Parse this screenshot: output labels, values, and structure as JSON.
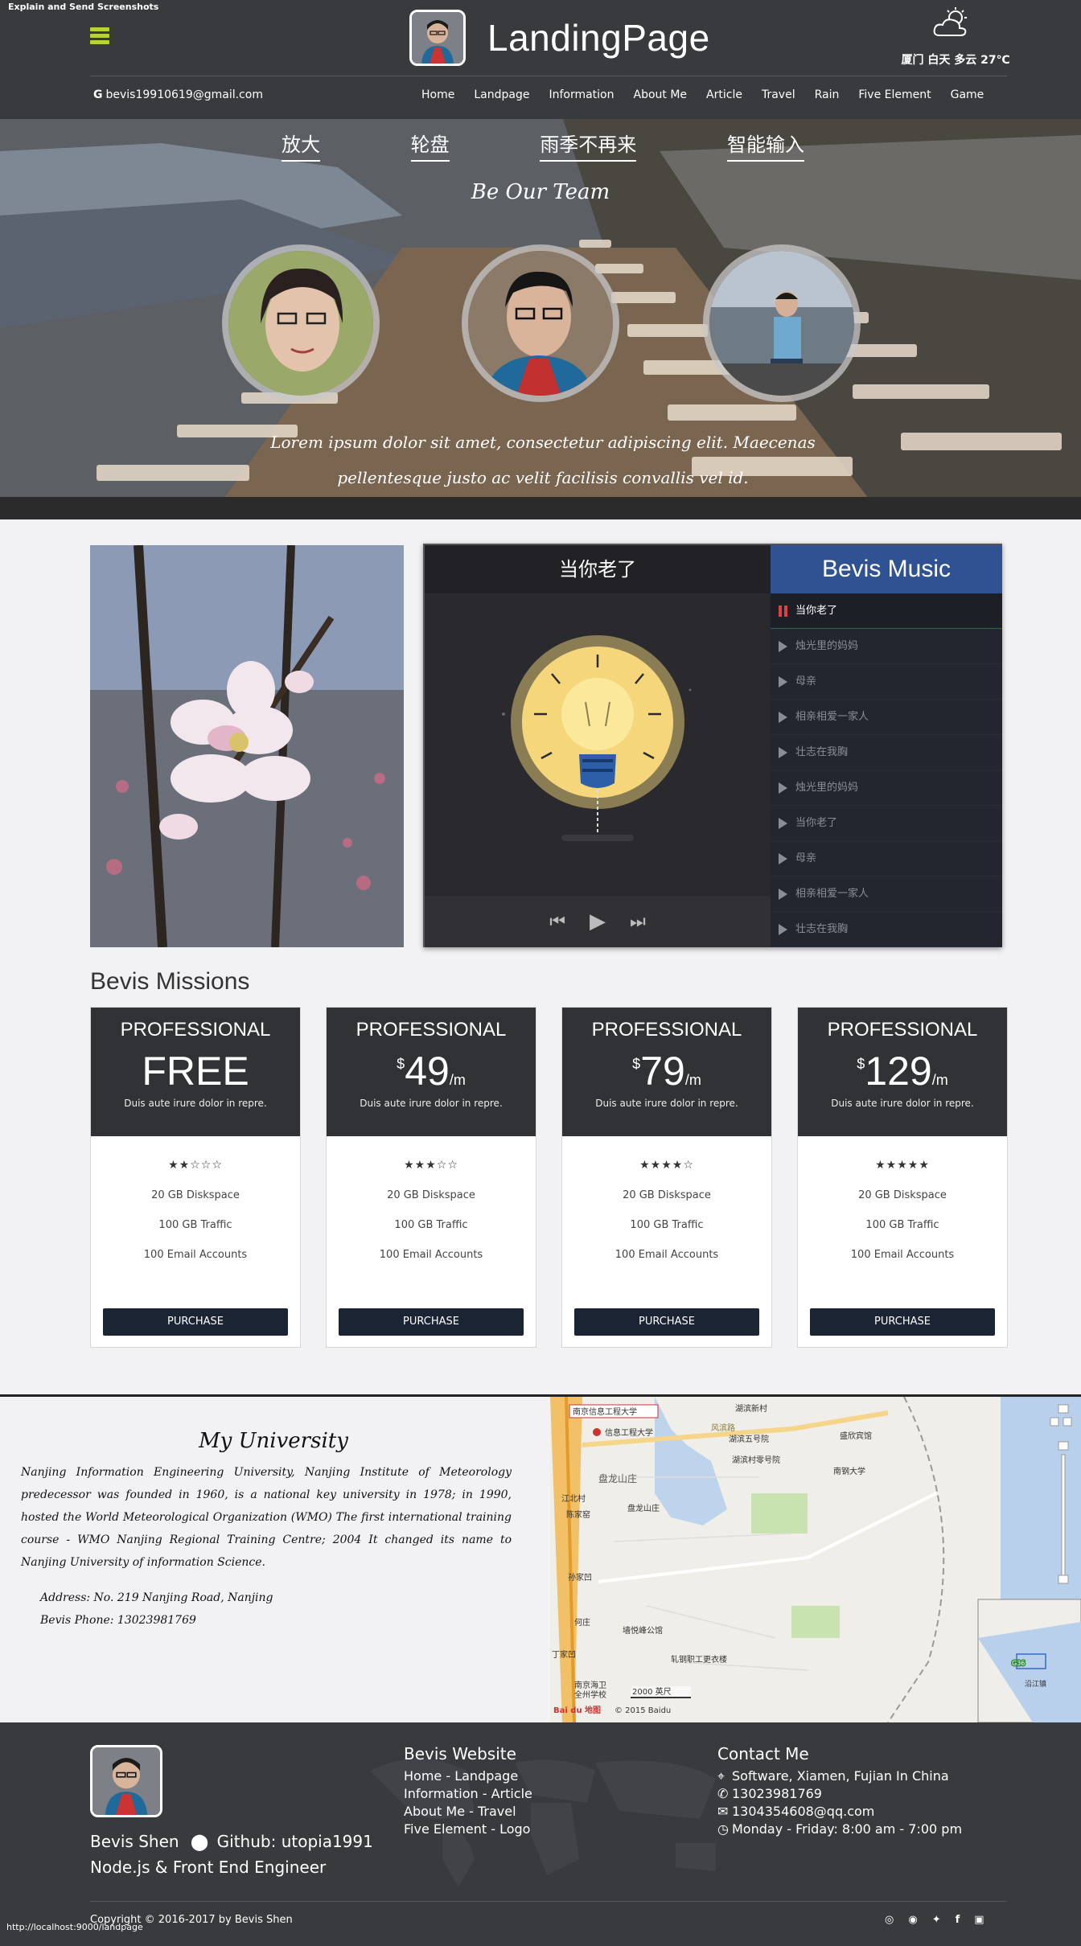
{
  "header": {
    "note": "Explain and Send Screenshots",
    "title": "LandingPage",
    "weather": "厦门 白天 多云 27℃",
    "email": "bevis19910619@gmail.com",
    "nav": [
      "Home",
      "Landpage",
      "Information",
      "About Me",
      "Article",
      "Travel",
      "Rain",
      "Five Element",
      "Game"
    ]
  },
  "hero": {
    "tabs": [
      "放大",
      "轮盘",
      "雨季不再来",
      "智能输入"
    ],
    "team_title": "Be Our Team",
    "text": "Lorem ipsum dolor sit amet, consectetur adipiscing elit. Maecenas pellentesque justo ac velit facilisis convallis vel id."
  },
  "player": {
    "song_title": "当你老了",
    "music_title": "Bevis Music",
    "playlist": [
      "当你老了",
      "烛光里的妈妈",
      "母亲",
      "相亲相爱一家人",
      "壮志在我胸",
      "烛光里的妈妈",
      "当你老了",
      "母亲",
      "相亲相爱一家人",
      "壮志在我胸"
    ]
  },
  "missions": {
    "title": "Bevis Missions",
    "plans": [
      {
        "name": "PROFESSIONAL",
        "currency": "",
        "price": "FREE",
        "per": "",
        "desc": "Duis aute irure dolor in repre.",
        "stars": "★★☆☆☆",
        "rating": 2.5,
        "features": [
          "20 GB Diskspace",
          "100 GB Traffic",
          "100 Email Accounts"
        ],
        "button": "PURCHASE"
      },
      {
        "name": "PROFESSIONAL",
        "currency": "$",
        "price": "49",
        "per": "/m",
        "desc": "Duis aute irure dolor in repre.",
        "stars": "★★★☆☆",
        "rating": 3,
        "features": [
          "20 GB Diskspace",
          "100 GB Traffic",
          "100 Email Accounts"
        ],
        "button": "PURCHASE"
      },
      {
        "name": "PROFESSIONAL",
        "currency": "$",
        "price": "79",
        "per": "/m",
        "desc": "Duis aute irure dolor in repre.",
        "stars": "★★★★☆",
        "rating": 4.5,
        "features": [
          "20 GB Diskspace",
          "100 GB Traffic",
          "100 Email Accounts"
        ],
        "button": "PURCHASE"
      },
      {
        "name": "PROFESSIONAL",
        "currency": "$",
        "price": "129",
        "per": "/m",
        "desc": "Duis aute irure dolor in repre.",
        "stars": "★★★★★",
        "rating": 5,
        "features": [
          "20 GB Diskspace",
          "100 GB Traffic",
          "100 Email Accounts"
        ],
        "button": "PURCHASE"
      }
    ]
  },
  "university": {
    "title": "My University",
    "body": "Nanjing Information Engineering University, Nanjing Institute of Meteorology predecessor was founded in 1960, is a national key university in 1978; in 1990, hosted the World Meteorological Organization (WMO) The first international training course - WMO Nanjing Regional Training Centre; 2004 It changed its name to Nanjing University of information Science.",
    "address": "Address: No. 219 Nanjing Road, Nanjing",
    "phone": "Bevis Phone: 13023981769"
  },
  "map": {
    "labels": [
      "南京信息工程大学",
      "信息工程大学",
      "盘龙山庄",
      "盘龙山庄",
      "湖滨新村",
      "湖滨五号院",
      "湖滨村零号院",
      "盛欣宾馆",
      "南钢大学",
      "风滨路",
      "江北村",
      "陈家窑",
      "孙家凹",
      "何庄",
      "墙悦峰公馆",
      "轧钢职工更衣楼",
      "丁家凹",
      "南京海卫",
      "全州学校",
      "沿江镇",
      "G36"
    ],
    "scale": "2000 英尺",
    "copyright": "© 2015 Baidu",
    "brand": "Bai du 地图"
  },
  "footer": {
    "name": "Bevis Shen",
    "github": "Github: utopia1991",
    "role": "Node.js & Front End Engineer",
    "website_title": "Bevis Website",
    "website_links": [
      "Home - Landpage",
      "Information - Article",
      "About Me - Travel",
      "Five Element - Logo"
    ],
    "contact_title": "Contact Me",
    "contact": {
      "address": "Software, Xiamen, Fujian In China",
      "phone": "13023981769",
      "email": "1304354608@qq.com",
      "hours": "Monday - Friday: 8:00 am - 7:00 pm"
    },
    "copyright": "Copyright © 2016-2017 by Bevis Shen",
    "social_icons": [
      "wechat-icon",
      "weibo-icon",
      "twitter-icon",
      "facebook-icon",
      "instagram-icon"
    ]
  },
  "status_url": "http://localhost:9000/landpage"
}
